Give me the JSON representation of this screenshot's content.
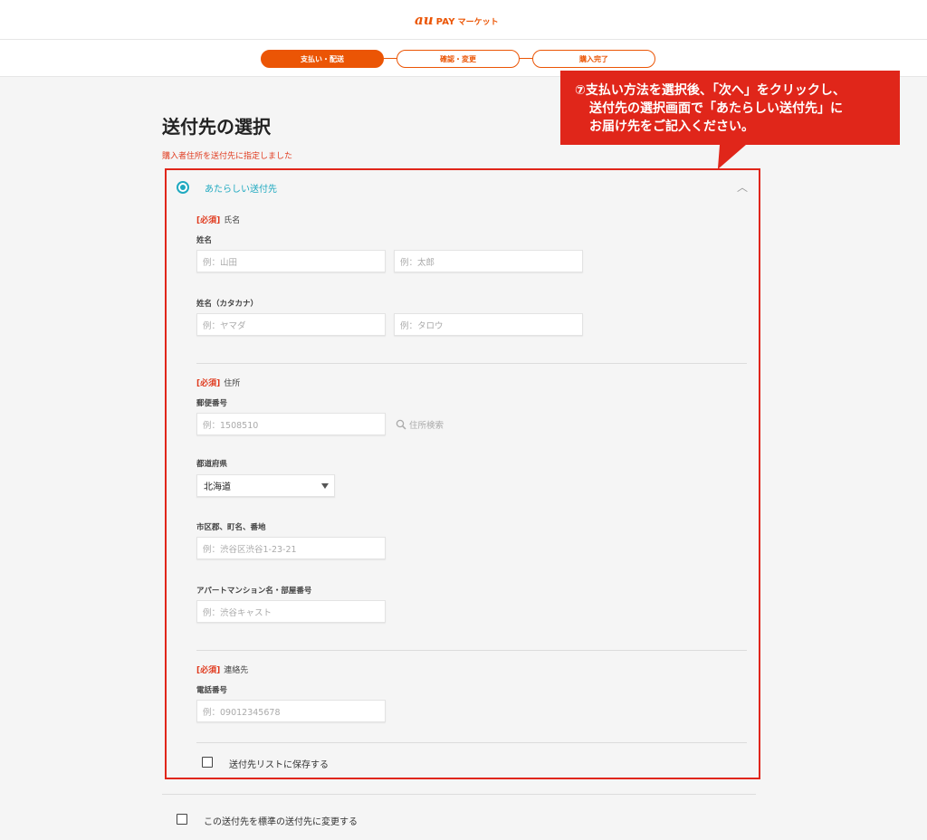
{
  "header": {
    "logo_au": "au",
    "logo_pay": "PAY",
    "logo_market": "マーケット"
  },
  "steps": [
    {
      "label": "支払い・配送",
      "active": true
    },
    {
      "label": "確認・変更",
      "active": false
    },
    {
      "label": "購入完了",
      "active": false
    }
  ],
  "page": {
    "title": "送付先の選択",
    "notice": "購入者住所を送付先に指定しました"
  },
  "callout": {
    "line1": "⑦支払い方法を選択後、「次へ」をクリックし、",
    "line2": "送付先の選択画面で「あたらしい送付先」に",
    "line3": "お届け先をご記入ください。"
  },
  "option": {
    "label": "あたらしい送付先"
  },
  "name_section": {
    "required": "[必須]",
    "title": "氏名",
    "kanji_label": "姓名",
    "last_placeholder": "例：山田",
    "first_placeholder": "例：太郎",
    "kana_label": "姓名（カタカナ）",
    "last_kana_placeholder": "例：ヤマダ",
    "first_kana_placeholder": "例：タロウ"
  },
  "address_section": {
    "required": "[必須]",
    "title": "住所",
    "postal_label": "郵便番号",
    "postal_placeholder": "例：1508510",
    "search_label": "住所検索",
    "prefecture_label": "都道府県",
    "prefecture_value": "北海道",
    "city_label": "市区郡、町名、番地",
    "city_placeholder": "例：渋谷区渋谷1-23-21",
    "building_label": "アパートマンション名・部屋番号",
    "building_placeholder": "例：渋谷キャスト"
  },
  "contact_section": {
    "required": "[必須]",
    "title": "連絡先",
    "phone_label": "電話番号",
    "phone_placeholder": "例：09012345678"
  },
  "save_to_list": "送付先リストに保存する",
  "set_default": "この送付先を標準の送付先に変更する"
}
